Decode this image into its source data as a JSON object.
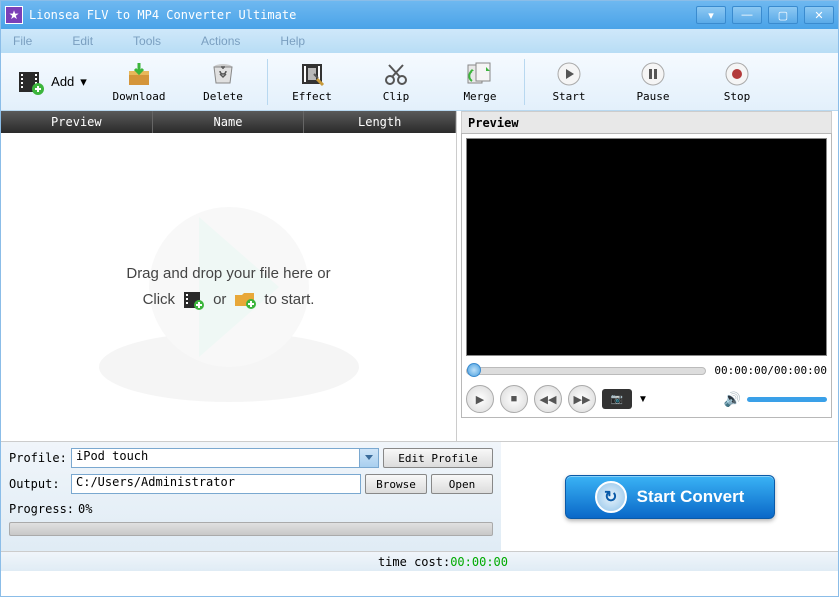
{
  "title": "Lionsea FLV to MP4 Converter Ultimate",
  "menu": {
    "file": "File",
    "edit": "Edit",
    "tools": "Tools",
    "actions": "Actions",
    "help": "Help"
  },
  "toolbar": {
    "add": "Add",
    "download": "Download",
    "delete": "Delete",
    "effect": "Effect",
    "clip": "Clip",
    "merge": "Merge",
    "start": "Start",
    "pause": "Pause",
    "stop": "Stop"
  },
  "columns": {
    "preview": "Preview",
    "name": "Name",
    "length": "Length"
  },
  "drop": {
    "line1": "Drag and drop your file here or",
    "click": "Click",
    "or": "or",
    "tostart": "to start."
  },
  "preview": {
    "header": "Preview",
    "time": "00:00:00/00:00:00"
  },
  "form": {
    "profile_label": "Profile:",
    "profile_value": "iPod touch",
    "edit_profile": "Edit Profile",
    "output_label": "Output:",
    "output_value": "C:/Users/Administrator",
    "browse": "Browse",
    "open": "Open",
    "progress_label": "Progress:",
    "progress_value": "0%"
  },
  "convert": "Start Convert",
  "status": {
    "label": "time cost:",
    "value": "00:00:00"
  }
}
